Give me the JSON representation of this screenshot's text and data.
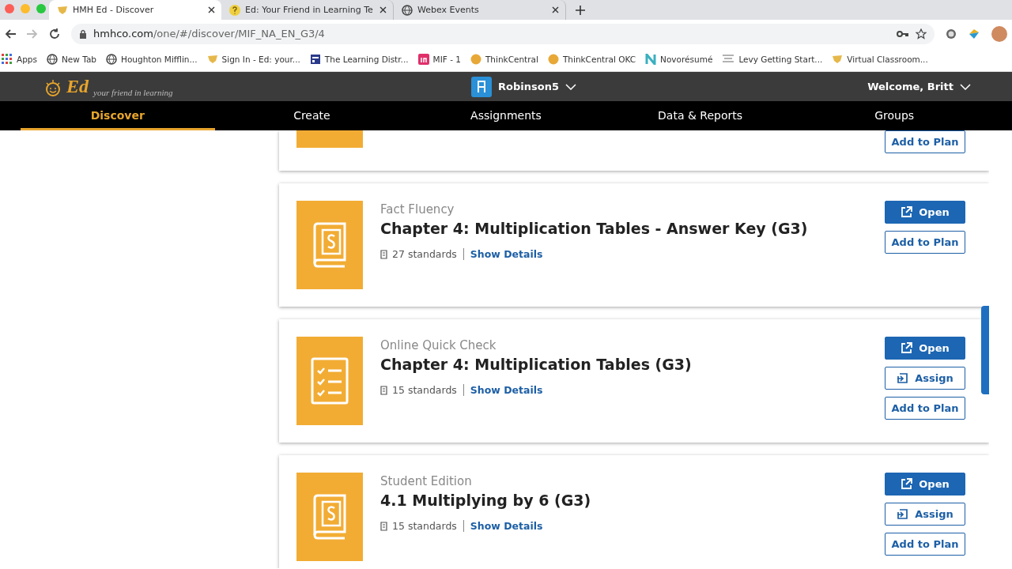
{
  "browser": {
    "tabs": [
      {
        "title": "HMH Ed - Discover",
        "selected": true,
        "kind": "shield"
      },
      {
        "title": "Ed: Your Friend in Learning Te",
        "selected": false,
        "kind": "question"
      },
      {
        "title": "Webex Events",
        "selected": false,
        "kind": "globe"
      }
    ],
    "url_host": "hmhco.com",
    "url_path": "/one/#/discover/MIF_NA_EN_G3/4",
    "bookmarks": [
      {
        "label": "Apps",
        "kind": "grid"
      },
      {
        "label": "New Tab",
        "kind": "globe"
      },
      {
        "label": "Houghton Mifflin...",
        "kind": "globe"
      },
      {
        "label": "Sign In - Ed: your...",
        "kind": "shield"
      },
      {
        "label": "The Learning Distr...",
        "kind": "window"
      },
      {
        "label": "MIF - 1",
        "kind": "in"
      },
      {
        "label": "ThinkCentral",
        "kind": "dot"
      },
      {
        "label": "ThinkCentral OKC",
        "kind": "dot"
      },
      {
        "label": "Novorésumé",
        "kind": "n"
      },
      {
        "label": "Levy Getting Start...",
        "kind": "lines"
      },
      {
        "label": "Virtual Classroom...",
        "kind": "shield"
      }
    ]
  },
  "app": {
    "logo": "Ed",
    "tagline": "your friend in learning",
    "class_name": "Robinson5",
    "welcome": "Welcome, Britt",
    "nav": [
      {
        "label": "Discover",
        "selected": true
      },
      {
        "label": "Create",
        "selected": false
      },
      {
        "label": "Assignments",
        "selected": false
      },
      {
        "label": "Data & Reports",
        "selected": false
      },
      {
        "label": "Groups",
        "selected": false
      }
    ]
  },
  "cards": [
    {
      "partial": true,
      "buttons": [
        {
          "kind": "plan",
          "label": "Add to Plan"
        }
      ]
    },
    {
      "partial": false,
      "kind": "book",
      "category": "Fact Fluency",
      "title": "Chapter 4: Multiplication Tables - Answer Key (G3)",
      "standards": "27 standards",
      "link": "Show Details",
      "buttons": [
        {
          "kind": "open",
          "label": "Open"
        },
        {
          "kind": "plan",
          "label": "Add to Plan"
        }
      ]
    },
    {
      "partial": false,
      "kind": "checklist",
      "category": "Online Quick Check",
      "title": "Chapter 4: Multiplication Tables (G3)",
      "standards": "15 standards",
      "link": "Show Details",
      "buttons": [
        {
          "kind": "open",
          "label": "Open"
        },
        {
          "kind": "assign",
          "label": "Assign"
        },
        {
          "kind": "plan",
          "label": "Add to Plan"
        }
      ]
    },
    {
      "partial": false,
      "kind": "book",
      "category": "Student Edition",
      "title": "4.1 Multiplying by 6 (G3)",
      "standards": "15 standards",
      "link": "Show Details",
      "buttons": [
        {
          "kind": "open",
          "label": "Open"
        },
        {
          "kind": "assign",
          "label": "Assign"
        },
        {
          "kind": "plan",
          "label": "Add to Plan"
        }
      ]
    }
  ]
}
